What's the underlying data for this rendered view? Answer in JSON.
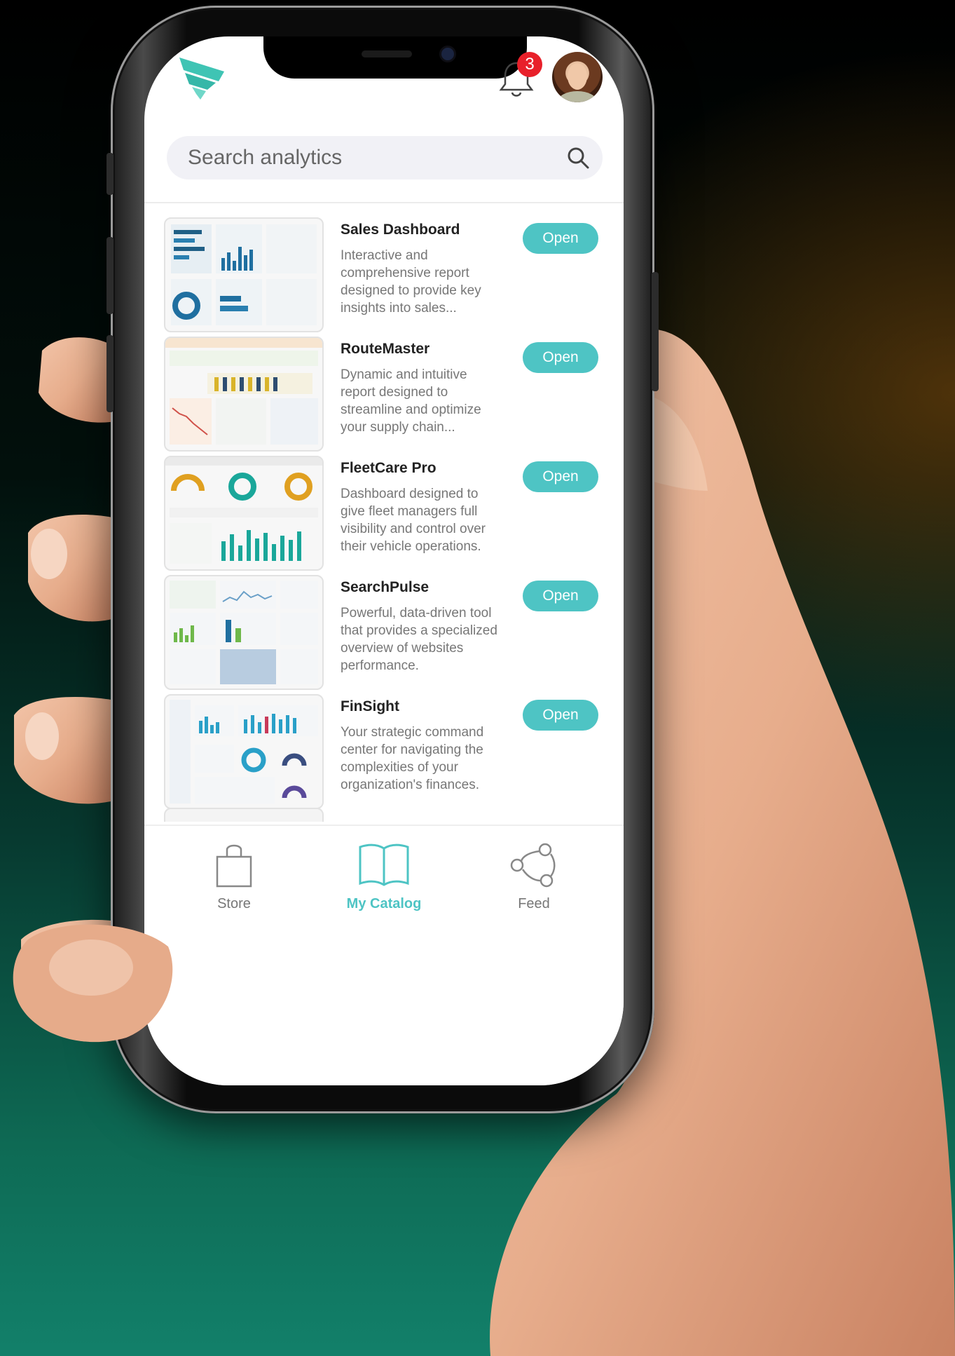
{
  "header": {
    "logo_icon": "brand-logo-icon",
    "notification_icon": "bell-icon",
    "notification_count": "3",
    "avatar_icon": "user-avatar"
  },
  "search": {
    "placeholder": "Search analytics",
    "icon": "search-icon"
  },
  "catalog": {
    "items": [
      {
        "title": "Sales Dashboard",
        "description": "Interactive and comprehensive report designed to provide key insights into sales...",
        "button": "Open"
      },
      {
        "title": "RouteMaster",
        "description": "Dynamic and intuitive report designed to streamline and optimize your supply chain...",
        "button": "Open"
      },
      {
        "title": "FleetCare Pro",
        "description": "Dashboard designed to give fleet managers full visibility and control over their vehicle operations.",
        "button": "Open"
      },
      {
        "title": "SearchPulse",
        "description": "Powerful, data-driven tool that provides a specialized overview of websites performance.",
        "button": "Open"
      },
      {
        "title": "FinSight",
        "description": "Your strategic command center for navigating the complexities of your organization's finances.",
        "button": "Open"
      }
    ]
  },
  "tabs": [
    {
      "label": "Store",
      "icon": "shopping-bag-icon",
      "active": false
    },
    {
      "label": "My Catalog",
      "icon": "open-book-icon",
      "active": true
    },
    {
      "label": "Feed",
      "icon": "network-icon",
      "active": false
    }
  ],
  "colors": {
    "accent": "#4ec4c4",
    "active_tab": "#4ec4c4",
    "inactive_tab": "#777777",
    "badge": "#e8202a"
  }
}
